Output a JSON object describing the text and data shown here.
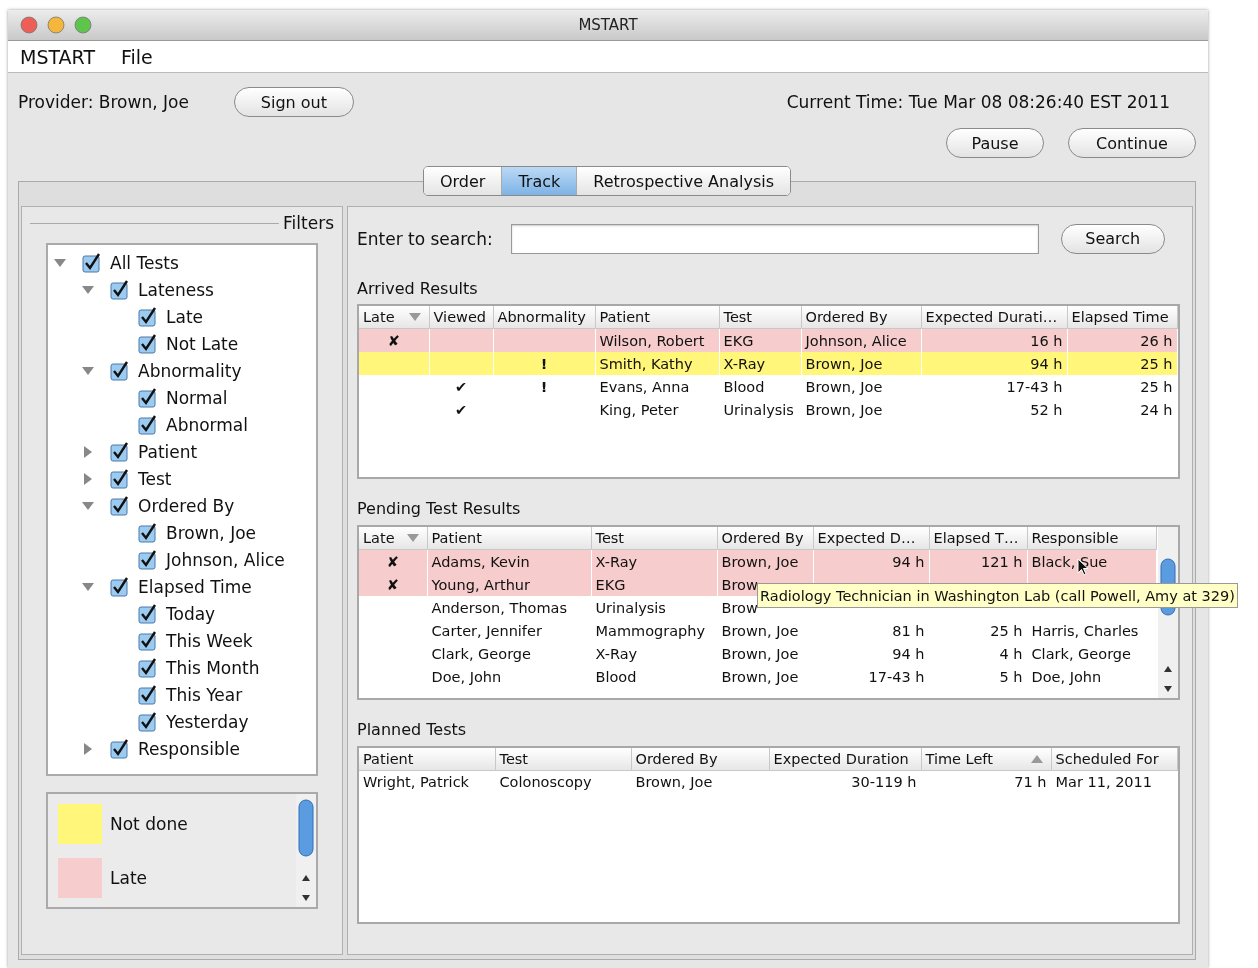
{
  "window": {
    "title": "MSTART"
  },
  "menu": [
    "MSTART",
    "File"
  ],
  "header": {
    "provider": "Provider: Brown, Joe",
    "sign_out": "Sign out",
    "current_time": "Current Time: Tue Mar 08 08:26:40 EST 2011",
    "buttons": [
      "Pause",
      "Continue"
    ]
  },
  "tabs": [
    {
      "label": "Order",
      "selected": false
    },
    {
      "label": "Track",
      "selected": true
    },
    {
      "label": "Retrospective Analysis",
      "selected": false
    }
  ],
  "filters": {
    "title": "Filters",
    "tree": [
      {
        "label": "All Tests",
        "checked": true,
        "expanded": true,
        "children": [
          {
            "label": "Lateness",
            "checked": true,
            "expanded": true,
            "children": [
              {
                "label": "Late",
                "checked": true
              },
              {
                "label": "Not Late",
                "checked": true
              }
            ]
          },
          {
            "label": "Abnormality",
            "checked": true,
            "expanded": true,
            "children": [
              {
                "label": "Normal",
                "checked": true
              },
              {
                "label": "Abnormal",
                "checked": true
              }
            ]
          },
          {
            "label": "Patient",
            "checked": true,
            "expanded": false
          },
          {
            "label": "Test",
            "checked": true,
            "expanded": false
          },
          {
            "label": "Ordered By",
            "checked": true,
            "expanded": true,
            "children": [
              {
                "label": "Brown, Joe",
                "checked": true
              },
              {
                "label": "Johnson, Alice",
                "checked": true
              }
            ]
          },
          {
            "label": "Elapsed Time",
            "checked": true,
            "expanded": true,
            "children": [
              {
                "label": "Today",
                "checked": true
              },
              {
                "label": "This Week",
                "checked": true
              },
              {
                "label": "This Month",
                "checked": true
              },
              {
                "label": "This Year",
                "checked": true
              },
              {
                "label": "Yesterday",
                "checked": true
              }
            ]
          },
          {
            "label": "Responsible",
            "checked": true,
            "expanded": false
          }
        ]
      }
    ],
    "legend": [
      {
        "label": "Not done",
        "color": "#fff67a"
      },
      {
        "label": "Late",
        "color": "#f6cccc"
      }
    ]
  },
  "search": {
    "label": "Enter to search:",
    "button": "Search"
  },
  "arrived_results": {
    "title": "Arrived Results",
    "columns": [
      {
        "label": "Late",
        "kind": "mark",
        "sorted": true,
        "ascending": false
      },
      {
        "label": "Viewed",
        "kind": "mark",
        "sorted": false
      },
      {
        "label": "Abnormality",
        "kind": "mark",
        "sorted": false
      },
      {
        "label": "Patient",
        "kind": "text",
        "sorted": false
      },
      {
        "label": "Test",
        "kind": "text",
        "sorted": false
      },
      {
        "label": "Ordered By",
        "kind": "text",
        "sorted": false
      },
      {
        "label": "Expected Durati…",
        "kind": "number",
        "sorted": false
      },
      {
        "label": "Elapsed Time",
        "kind": "number",
        "sorted": false
      }
    ],
    "rows": [
      {
        "late": true,
        "not_done": false,
        "cells": [
          "✘",
          null,
          null,
          "Wilson, Robert",
          "EKG",
          "Johnson, Alice",
          "16 h",
          "26 h"
        ]
      },
      {
        "late": false,
        "not_done": true,
        "cells": [
          null,
          null,
          "!",
          "Smith, Kathy",
          "X-Ray",
          "Brown, Joe",
          "94 h",
          "25 h"
        ]
      },
      {
        "late": false,
        "not_done": false,
        "cells": [
          null,
          "✔",
          "!",
          "Evans, Anna",
          "Blood",
          "Brown, Joe",
          "17-43 h",
          "25 h"
        ]
      },
      {
        "late": false,
        "not_done": false,
        "cells": [
          null,
          "✔",
          null,
          "King, Peter",
          "Urinalysis",
          "Brown, Joe",
          "52 h",
          "24 h"
        ]
      }
    ]
  },
  "pending_test_results": {
    "title": "Pending Test Results",
    "columns": [
      {
        "label": "Late",
        "kind": "mark",
        "sorted": true,
        "ascending": false
      },
      {
        "label": "Patient",
        "kind": "text",
        "sorted": false
      },
      {
        "label": "Test",
        "kind": "text",
        "sorted": false
      },
      {
        "label": "Ordered By",
        "kind": "text",
        "sorted": false
      },
      {
        "label": "Expected D…",
        "kind": "number",
        "sorted": false
      },
      {
        "label": "Elapsed T…",
        "kind": "number",
        "sorted": false
      },
      {
        "label": "Responsible",
        "kind": "text",
        "sorted": false
      }
    ],
    "rows": [
      {
        "late": true,
        "not_done": false,
        "cells": [
          "✘",
          "Adams, Kevin",
          "X-Ray",
          "Brown, Joe",
          "94 h",
          "121 h",
          "Black, Sue"
        ]
      },
      {
        "late": true,
        "not_done": false,
        "cells": [
          "✘",
          "Young, Arthur",
          "EKG",
          "Brow",
          null,
          null,
          null
        ]
      },
      {
        "late": false,
        "not_done": false,
        "cells": [
          null,
          "Anderson, Thomas",
          "Urinalysis",
          "Brow",
          null,
          null,
          null
        ]
      },
      {
        "late": false,
        "not_done": false,
        "cells": [
          null,
          "Carter, Jennifer",
          "Mammography",
          "Brown, Joe",
          "81 h",
          "25 h",
          "Harris, Charles"
        ]
      },
      {
        "late": false,
        "not_done": false,
        "cells": [
          null,
          "Clark, George",
          "X-Ray",
          "Brown, Joe",
          "94 h",
          "4 h",
          "Clark, George"
        ]
      },
      {
        "late": false,
        "not_done": false,
        "cells": [
          null,
          "Doe, John",
          "Blood",
          "Brown, Joe",
          "17-43 h",
          "5 h",
          "Doe, John"
        ]
      }
    ],
    "tooltip": "Radiology Technician in Washington Lab (call Powell, Amy at 329)"
  },
  "planned_tests": {
    "title": "Planned Tests",
    "columns": [
      {
        "label": "Patient",
        "kind": "text",
        "sorted": false
      },
      {
        "label": "Test",
        "kind": "text",
        "sorted": false
      },
      {
        "label": "Ordered By",
        "kind": "text",
        "sorted": false
      },
      {
        "label": "Expected Duration",
        "kind": "number",
        "sorted": false
      },
      {
        "label": "Time Left",
        "kind": "number",
        "sorted": true,
        "ascending": true
      },
      {
        "label": "Scheduled For",
        "kind": "text",
        "sorted": false
      }
    ],
    "rows": [
      {
        "late": false,
        "not_done": false,
        "cells": [
          "Wright, Patrick",
          "Colonoscopy",
          "Brown, Joe",
          "30-119 h",
          "71 h",
          "Mar 11, 2011"
        ]
      }
    ]
  }
}
